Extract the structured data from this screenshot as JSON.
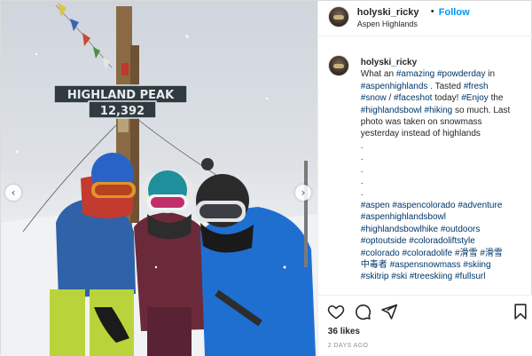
{
  "post": {
    "username": "holyski_ricky",
    "follow_label": "Follow",
    "separator": "•",
    "location": "Aspen Highlands",
    "sign": {
      "line1": "HIGHLAND PEAK",
      "line2": "12,392"
    },
    "caption": {
      "lines": [
        [
          {
            "t": "username",
            "v": "holyski_ricky"
          }
        ],
        [
          {
            "t": "text",
            "v": "What an "
          },
          {
            "t": "tag",
            "v": "#amazing"
          },
          {
            "t": "text",
            "v": " "
          },
          {
            "t": "tag",
            "v": "#powderday"
          },
          {
            "t": "text",
            "v": " in"
          }
        ],
        [
          {
            "t": "tag",
            "v": "#aspenhighlands"
          },
          {
            "t": "text",
            "v": " . Tasted "
          },
          {
            "t": "tag",
            "v": "#fresh"
          }
        ],
        [
          {
            "t": "tag",
            "v": "#snow"
          },
          {
            "t": "text",
            "v": " / "
          },
          {
            "t": "tag",
            "v": "#faceshot"
          },
          {
            "t": "text",
            "v": " today! "
          },
          {
            "t": "tag",
            "v": "#Enjoy"
          },
          {
            "t": "text",
            "v": " the"
          }
        ],
        [
          {
            "t": "tag",
            "v": "#highlandsbowl"
          },
          {
            "t": "text",
            "v": " "
          },
          {
            "t": "tag",
            "v": "#hiking"
          },
          {
            "t": "text",
            "v": " so much. Last"
          }
        ],
        [
          {
            "t": "text",
            "v": "photo was taken on snowmass"
          }
        ],
        [
          {
            "t": "text",
            "v": "yesterday instead of highlands"
          }
        ],
        [
          {
            "t": "text",
            "v": " "
          }
        ],
        [
          {
            "t": "text",
            "v": "."
          }
        ],
        [
          {
            "t": "text",
            "v": "."
          }
        ],
        [
          {
            "t": "text",
            "v": "."
          }
        ],
        [
          {
            "t": "text",
            "v": "."
          }
        ],
        [
          {
            "t": "text",
            "v": "."
          }
        ],
        [
          {
            "t": "tag",
            "v": "#aspen"
          },
          {
            "t": "text",
            "v": " "
          },
          {
            "t": "tag",
            "v": "#aspencolorado"
          },
          {
            "t": "text",
            "v": " "
          },
          {
            "t": "tag",
            "v": "#adventure"
          }
        ],
        [
          {
            "t": "tag",
            "v": "#aspenhighlandsbowl"
          }
        ],
        [
          {
            "t": "tag",
            "v": "#highlandsbowlhike"
          },
          {
            "t": "text",
            "v": " "
          },
          {
            "t": "tag",
            "v": "#outdoors"
          }
        ],
        [
          {
            "t": "tag",
            "v": "#optoutside"
          },
          {
            "t": "text",
            "v": " "
          },
          {
            "t": "tag",
            "v": "#coloradoliftstyle"
          }
        ],
        [
          {
            "t": "tag",
            "v": "#colorado"
          },
          {
            "t": "text",
            "v": " "
          },
          {
            "t": "tag",
            "v": "#coloradolife"
          },
          {
            "t": "text",
            "v": " "
          },
          {
            "t": "tag",
            "v": "#滑雪"
          },
          {
            "t": "text",
            "v": " "
          },
          {
            "t": "tag",
            "v": "#滑雪"
          }
        ],
        [
          {
            "t": "tag",
            "v": "中毒者"
          },
          {
            "t": "text",
            "v": " "
          },
          {
            "t": "tag",
            "v": "#aspensnowmass"
          },
          {
            "t": "text",
            "v": " "
          },
          {
            "t": "tag",
            "v": "#skiing"
          }
        ],
        [
          {
            "t": "tag",
            "v": "#skitrip"
          },
          {
            "t": "text",
            "v": " "
          },
          {
            "t": "tag",
            "v": "#ski"
          },
          {
            "t": "text",
            "v": " "
          },
          {
            "t": "tag",
            "v": "#treeskiing"
          },
          {
            "t": "text",
            "v": " "
          },
          {
            "t": "tag",
            "v": "#fullsurl"
          }
        ]
      ]
    },
    "likes": "36 likes",
    "date": "2 DAYS AGO",
    "icons": {
      "like": "heart-icon",
      "comment": "comment-icon",
      "share": "share-icon",
      "save": "bookmark-icon",
      "prev": "chevron-left-icon",
      "next": "chevron-right-icon"
    },
    "colors": {
      "link": "#0095f6",
      "hashtag": "#00376b",
      "text": "#262626",
      "muted": "#8e8e8e"
    }
  }
}
